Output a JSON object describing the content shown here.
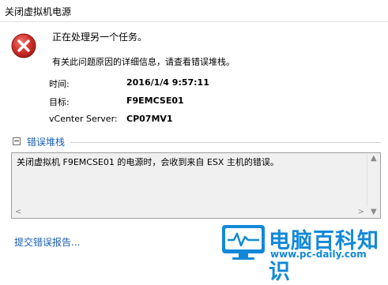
{
  "window": {
    "title": "关闭虚拟机电源"
  },
  "message": {
    "main": "正在处理另一个任务。",
    "detail": "有关此问题原因的详细信息，请查看错误堆栈。"
  },
  "details": [
    {
      "label": "时间:",
      "value": "2016/1/4 9:57:11"
    },
    {
      "label": "目标:",
      "value": "F9EMCSE01"
    },
    {
      "label": "vCenter Server:",
      "value": "CP07MV1"
    }
  ],
  "error_stack": {
    "label": "错误堆栈",
    "text": "关闭虚拟机 F9EMCSE01 的电源时，会收到来自 ESX 主机的错误。"
  },
  "report_link": "提交错误报告...",
  "watermark": {
    "name": "电脑百科知识",
    "url": "www.pc-daily.com"
  },
  "colors": {
    "link": "#1a5fb4",
    "error_icon": "#c62828",
    "watermark": "#1289d8"
  }
}
